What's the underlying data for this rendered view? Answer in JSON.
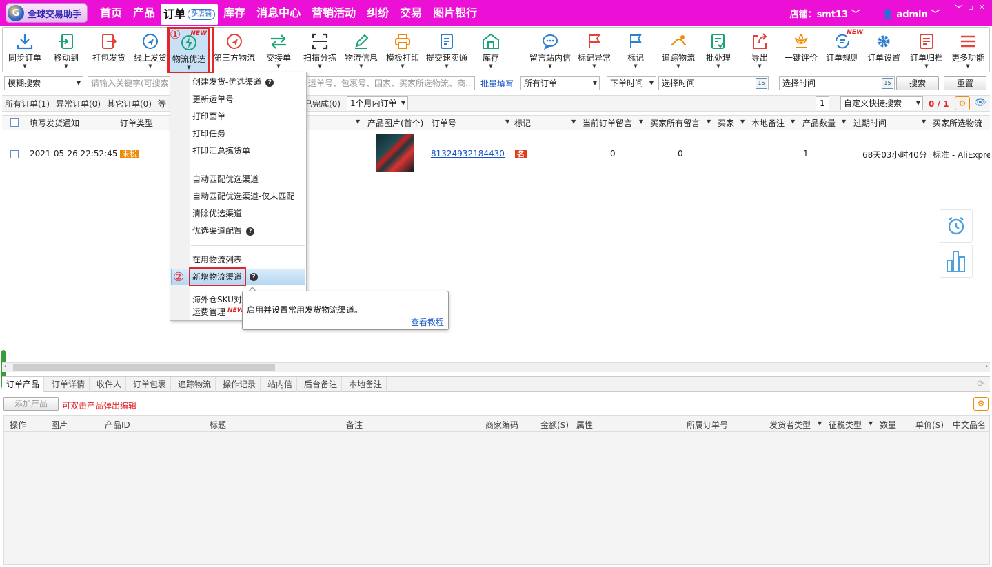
{
  "app": {
    "name": "全球交易助手",
    "logo_letter": "G"
  },
  "nav": {
    "items": [
      "首页",
      "产品",
      "订单",
      "库存",
      "消息中心",
      "营销活动",
      "纠纷",
      "交易",
      "图片银行"
    ],
    "active": "订单",
    "active_badge": "多店铺"
  },
  "header": {
    "store": "店铺：smt13",
    "user": "admin",
    "window_buttons": [
      "﹀",
      "▫",
      "✕"
    ]
  },
  "toolbar": [
    {
      "label": "同步订单",
      "icon": "download-icon",
      "dropdown": true
    },
    {
      "label": "移动到",
      "icon": "move-icon",
      "dropdown": true
    },
    {
      "label": "打包发货",
      "icon": "pack-ship-icon"
    },
    {
      "label": "线上发货",
      "icon": "plane-icon",
      "dropdown": true
    },
    {
      "label": "物流优选",
      "icon": "lightning-icon",
      "dropdown": true,
      "badge": "NEW",
      "selected": true
    },
    {
      "label": "第三方物流",
      "icon": "plane-circle-icon"
    },
    {
      "label": "交接单",
      "icon": "swap-arrows-icon",
      "dropdown": true
    },
    {
      "label": "扫描分拣",
      "icon": "scan-icon",
      "dropdown": true
    },
    {
      "label": "物流信息",
      "icon": "pencil-icon",
      "dropdown": true
    },
    {
      "label": "模板打印",
      "icon": "printer-icon",
      "dropdown": true
    },
    {
      "label": "提交速卖通",
      "icon": "document-icon",
      "dropdown": true
    },
    {
      "label": "库存",
      "icon": "warehouse-icon",
      "dropdown": true
    },
    {
      "label": "留言站内信",
      "icon": "chat-icon",
      "dropdown": true
    },
    {
      "label": "标记异常",
      "icon": "flag-red-icon",
      "dropdown": true
    },
    {
      "label": "标记",
      "icon": "flag-blue-icon",
      "dropdown": true
    },
    {
      "label": "追踪物流",
      "icon": "track-icon",
      "dropdown": true
    },
    {
      "label": "批处理",
      "icon": "batch-icon",
      "dropdown": true
    },
    {
      "label": "导出",
      "icon": "export-icon",
      "dropdown": true
    },
    {
      "label": "一键评价",
      "icon": "rate-icon"
    },
    {
      "label": "订单规则",
      "icon": "rules-icon",
      "badge": "NEW"
    },
    {
      "label": "订单设置",
      "icon": "gear-icon"
    },
    {
      "label": "订单归档",
      "icon": "archive-icon",
      "dropdown": true
    },
    {
      "label": "更多功能",
      "icon": "menu-icon",
      "dropdown": true
    }
  ],
  "filter": {
    "search_mode": "模糊搜索",
    "keyword_placeholder": "请输入关键字(可搜索",
    "keyword2_placeholder": "运单号、包裹号、国家、买家所选物流、商...",
    "batch_fill": "批量填写",
    "order_scope": "所有订单",
    "time_type": "下单时间",
    "start_placeholder": "选择时间",
    "dash": "-",
    "end_placeholder": "选择时间",
    "search_btn": "搜索",
    "reset_btn": "重置",
    "calendar": "15"
  },
  "status_tabs": {
    "items": [
      "所有订单(1)",
      "异常订单(0)",
      "其它订单(0)",
      "等",
      "已完成(0)"
    ],
    "period": "1个月内订单",
    "page": "1",
    "quick_search": "自定义快捷搜索",
    "counter": "0 / 1"
  },
  "grid": {
    "columns": [
      "填写发货通知",
      "订单类型",
      "产品图片(首个)",
      "订单号",
      "标记",
      "当前订单留言",
      "买家所有留言",
      "买家",
      "本地备注",
      "产品数量",
      "过期时间",
      "买家所选物流"
    ],
    "rows": [
      {
        "date": "2021-05-26 22:52:45",
        "type": "未税",
        "order_no": "813249321844306",
        "mark": "名",
        "cur_msg": "0",
        "all_msg": "0",
        "qty": "1",
        "expire": "68天03小时40分",
        "logistics": "标准 - AliExpre"
      }
    ]
  },
  "menu": {
    "items": [
      {
        "label": "创建发货-优选渠道",
        "help": true
      },
      {
        "label": "更新运单号"
      },
      {
        "label": "打印面单"
      },
      {
        "label": "打印任务"
      },
      {
        "label": "打印汇总拣货单"
      },
      {
        "label": "自动匹配优选渠道"
      },
      {
        "label": "自动匹配优选渠道-仅未匹配"
      },
      {
        "label": "清除优选渠道"
      },
      {
        "label": "优选渠道配置",
        "help": true
      },
      {
        "label": "在用物流列表"
      },
      {
        "label": "新增物流渠道",
        "help": true,
        "highlighted": true
      },
      {
        "label": "海外仓SKU对"
      },
      {
        "label": "运费管理",
        "badge": "NEW"
      }
    ],
    "help_glyph": "?"
  },
  "tooltip": {
    "text": "启用并设置常用发货物流渠道。",
    "link": "查看教程"
  },
  "annotations": {
    "step1": "①",
    "step2": "②"
  },
  "bottom": {
    "tabs": [
      "订单产品",
      "订单详情",
      "收件人",
      "订单包裹",
      "追踪物流",
      "操作记录",
      "站内信",
      "后台备注",
      "本地备注"
    ],
    "add_btn": "添加产品",
    "hint": "可双击产品弹出编辑",
    "columns": [
      "操作",
      "图片",
      "产品ID",
      "标题",
      "备注",
      "商家编码",
      "金额($)",
      "属性",
      "所属订单号",
      "发货者类型",
      "征税类型",
      "数量",
      "单价($)",
      "中文品名"
    ]
  },
  "colors": {
    "topbar": "#ec0fd6",
    "accent_red": "#e3262a",
    "link": "#1655c7",
    "selected_bg": "#c9e1f6"
  }
}
